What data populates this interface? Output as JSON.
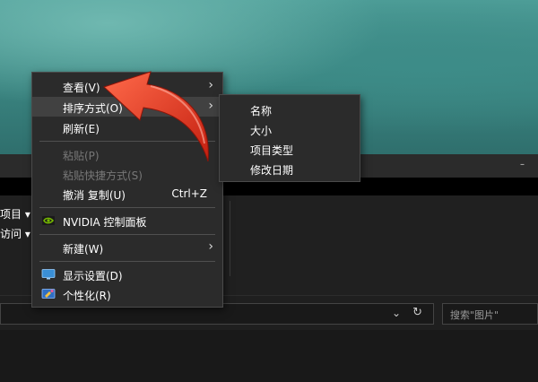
{
  "explorer": {
    "ribbon_items": [
      "项目 ▾",
      "访问 ▾"
    ],
    "search_placeholder": "搜索\"图片\"",
    "titlebar_min": "–"
  },
  "context_menu": {
    "items": [
      {
        "label": "查看(V)",
        "submenu": true
      },
      {
        "label": "排序方式(O)",
        "submenu": true,
        "highlighted": true
      },
      {
        "label": "刷新(E)"
      },
      {
        "label": "粘贴(P)",
        "disabled": true
      },
      {
        "label": "粘贴快捷方式(S)",
        "disabled": true
      },
      {
        "label": "撤消 复制(U)",
        "shortcut": "Ctrl+Z"
      },
      {
        "label": "NVIDIA 控制面板",
        "icon": "nvidia-icon"
      },
      {
        "label": "新建(W)",
        "submenu": true
      },
      {
        "label": "显示设置(D)",
        "icon": "display-settings-icon"
      },
      {
        "label": "个性化(R)",
        "icon": "personalize-icon"
      }
    ],
    "submenu_arrow": "›"
  },
  "sort_submenu": {
    "items": [
      "名称",
      "大小",
      "项目类型",
      "修改日期"
    ]
  },
  "colors": {
    "menu_bg": "#2b2b2b",
    "menu_highlight": "#414141",
    "annotation_arrow": "#e0301e",
    "nvidia_green": "#76b900"
  }
}
